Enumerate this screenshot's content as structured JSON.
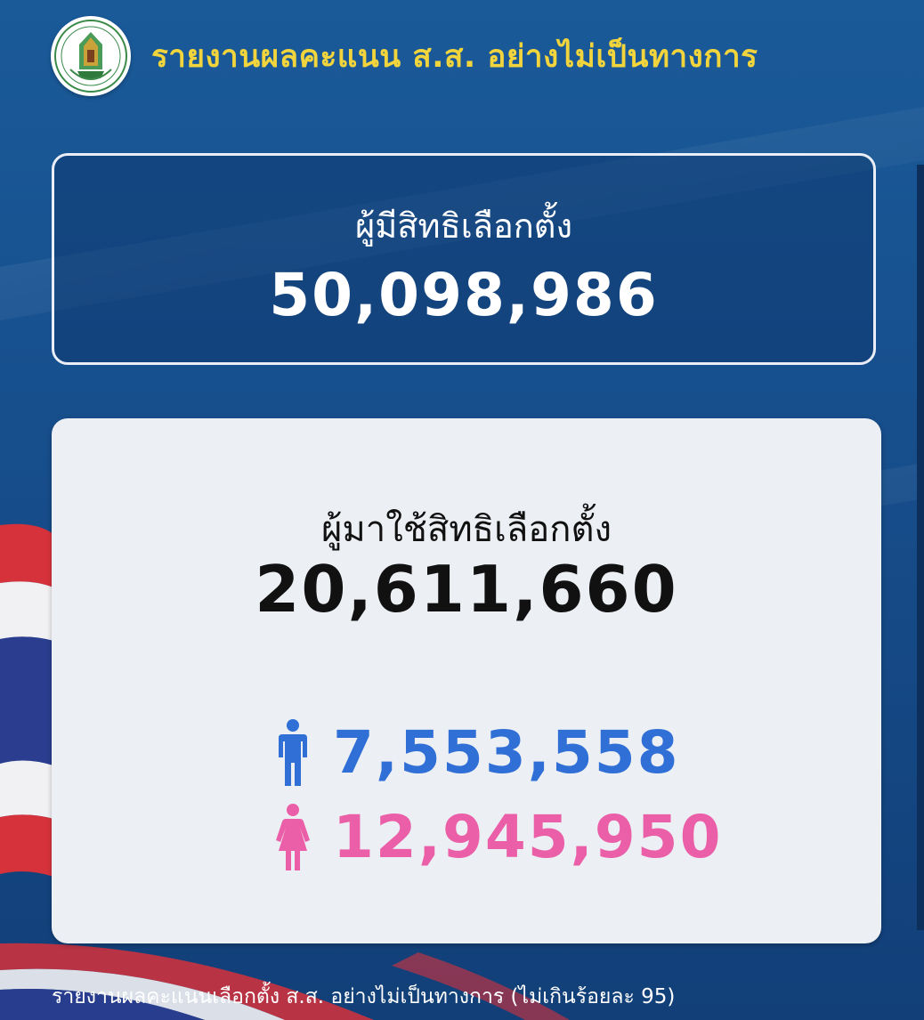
{
  "header": {
    "title": "รายงานผลคะแนน ส.ส. อย่างไม่เป็นทางการ",
    "logo_icon": "election-commission-seal-icon"
  },
  "eligible": {
    "label": "ผู้มีสิทธิเลือกตั้ง",
    "count": "50,098,986"
  },
  "turnout": {
    "label": "ผู้มาใช้สิทธิเลือกตั้ง",
    "count": "20,611,660",
    "male": {
      "icon": "male-person-icon",
      "count": "7,553,558",
      "color": "#2f6fd6"
    },
    "female": {
      "icon": "female-person-icon",
      "count": "12,945,950",
      "color": "#ea5fa7"
    }
  },
  "footer": {
    "note": "รายงานผลคะแนนเลือกตั้ง ส.ส. อย่างไม่เป็นทางการ (ไม่เกินร้อยละ 95)"
  },
  "colors": {
    "background": "#174f8d",
    "title_gold": "#f2d43c",
    "card_bg": "#eceff4"
  }
}
